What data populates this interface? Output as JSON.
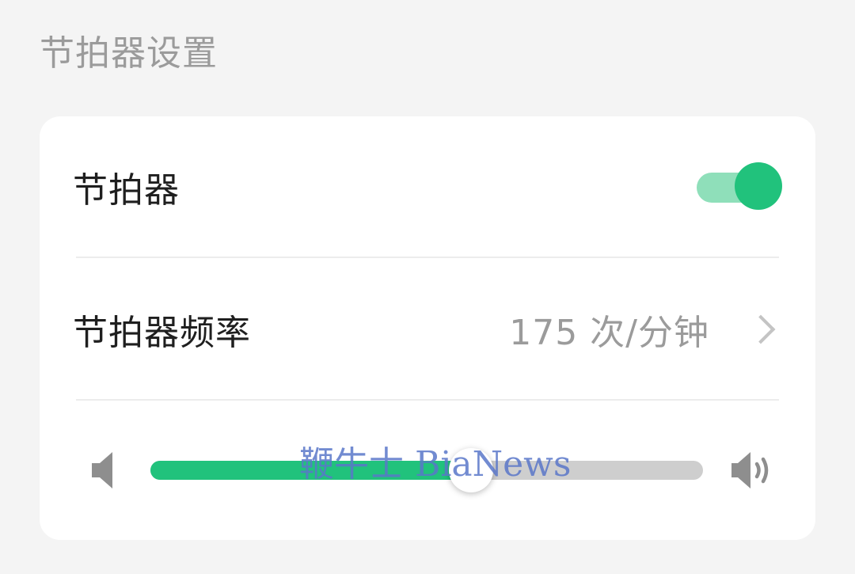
{
  "section": {
    "title": "节拍器设置"
  },
  "metronome": {
    "label": "节拍器",
    "enabled": true
  },
  "frequency": {
    "label": "节拍器频率",
    "value": "175 次/分钟",
    "chevron_icon": "chevron-right-icon"
  },
  "volume": {
    "level": 0.58,
    "low_icon": "speaker-low-icon",
    "high_icon": "speaker-high-icon"
  },
  "watermark": "鞭牛士 BiaNews",
  "colors": {
    "accent": "#21c27c",
    "accent_light": "#8fdfba",
    "track": "#cecece",
    "muted_text": "#9b9b9b"
  }
}
